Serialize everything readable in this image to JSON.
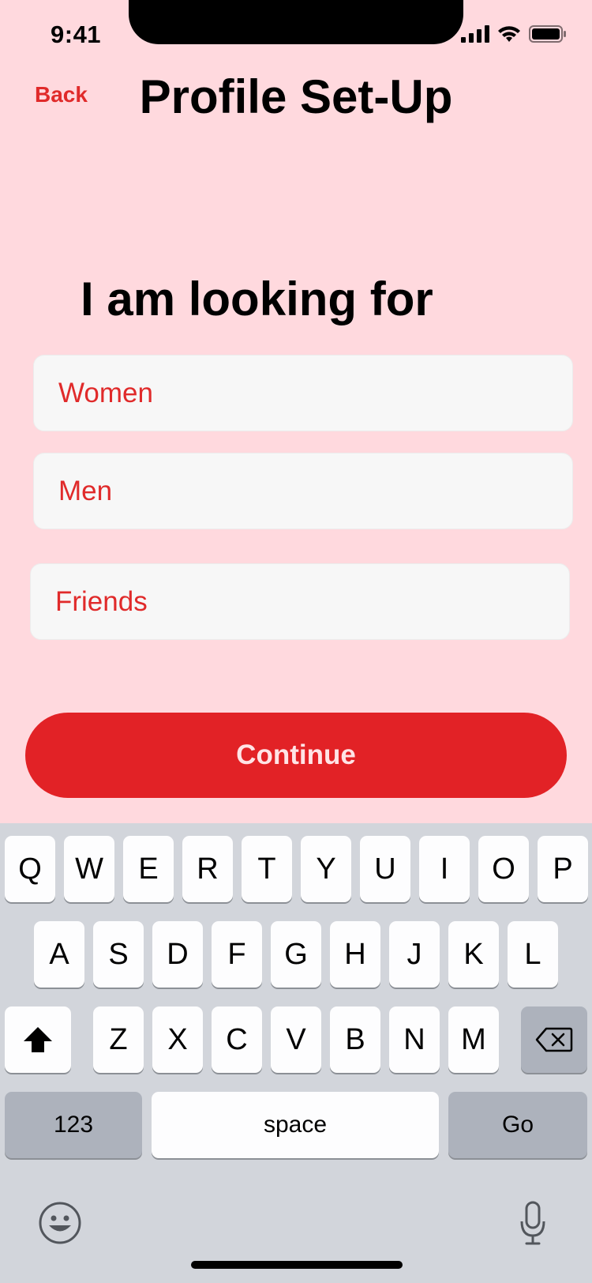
{
  "status_bar": {
    "time": "9:41"
  },
  "header": {
    "back_label": "Back",
    "title": "Profile Set-Up"
  },
  "main": {
    "subtitle": "I am looking for",
    "options": [
      "Women",
      "Men",
      "Friends"
    ],
    "continue_label": "Continue"
  },
  "keyboard": {
    "row1": [
      "Q",
      "W",
      "E",
      "R",
      "T",
      "Y",
      "U",
      "I",
      "O",
      "P"
    ],
    "row2": [
      "A",
      "S",
      "D",
      "F",
      "G",
      "H",
      "J",
      "K",
      "L"
    ],
    "row3": [
      "Z",
      "X",
      "C",
      "V",
      "B",
      "N",
      "M"
    ],
    "numbers_label": "123",
    "space_label": "space",
    "go_label": "Go"
  },
  "colors": {
    "background": "#ffd9de",
    "accent": "#e22226",
    "option_background": "#f7f7f7",
    "keyboard_background": "#d2d5db"
  }
}
